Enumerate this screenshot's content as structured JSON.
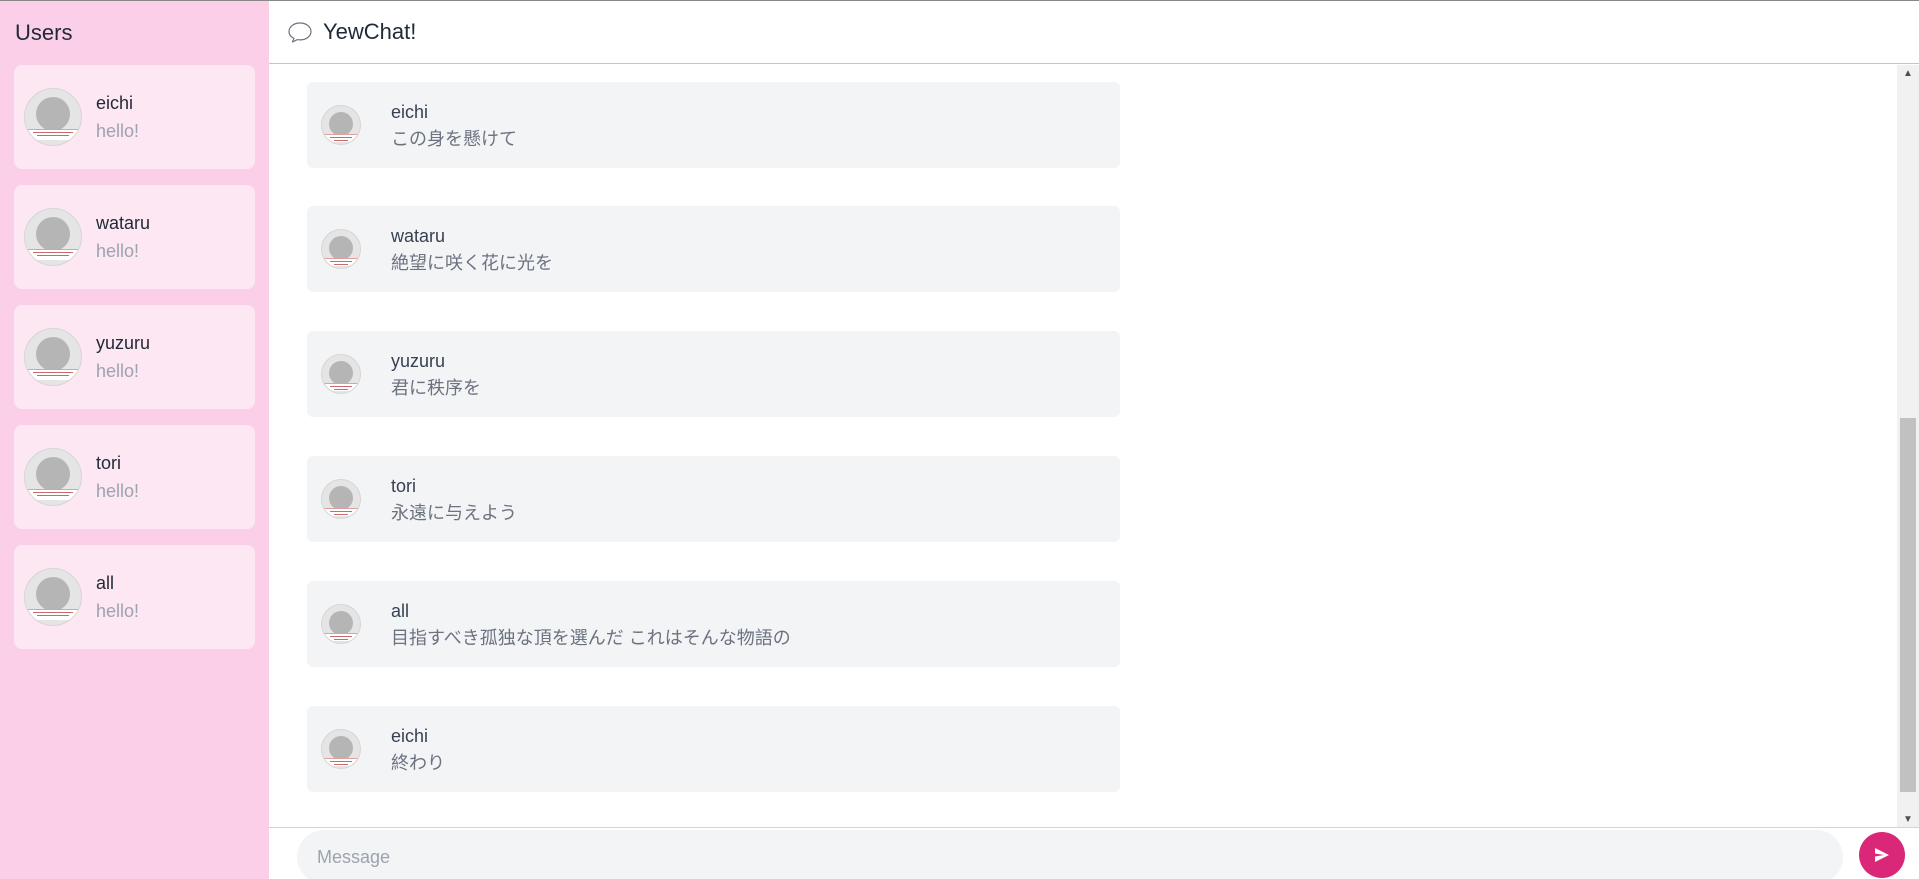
{
  "sidebar": {
    "title": "Users",
    "users": [
      {
        "name": "eichi",
        "status": "hello!"
      },
      {
        "name": "wataru",
        "status": "hello!"
      },
      {
        "name": "yuzuru",
        "status": "hello!"
      },
      {
        "name": "tori",
        "status": "hello!"
      },
      {
        "name": "all",
        "status": "hello!"
      }
    ]
  },
  "header": {
    "title": "YewChat!",
    "icon": "speech-bubble-icon"
  },
  "messages": [
    {
      "from": "eichi",
      "text": "この身を懸けて"
    },
    {
      "from": "wataru",
      "text": "絶望に咲く花に光を"
    },
    {
      "from": "yuzuru",
      "text": "君に秩序を"
    },
    {
      "from": "tori",
      "text": "永遠に与えよう"
    },
    {
      "from": "all",
      "text": "目指すべき孤独な頂を選んだ これはそんな物語の"
    },
    {
      "from": "eichi",
      "text": "終わり"
    }
  ],
  "composer": {
    "placeholder": "Message",
    "value": "",
    "send_icon": "send-icon"
  },
  "colors": {
    "sidebar_bg": "#fbcfe8",
    "card_bg": "#fce7f3",
    "message_bg": "#f3f4f6",
    "accent": "#db2777"
  }
}
